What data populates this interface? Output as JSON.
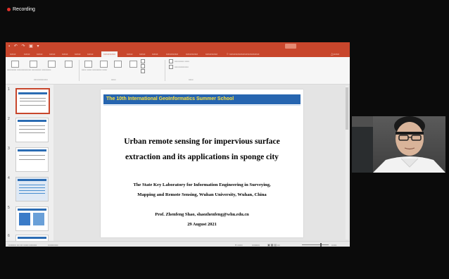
{
  "recording": {
    "label": "Recording"
  },
  "colors": {
    "accent": "#c8462c",
    "slide_banner": "#2665b0",
    "banner_text": "#ffe13a"
  },
  "slide": {
    "banner": "The 10th International GeoInformatics Summer School",
    "title_line1": "Urban remote sensing for impervious surface",
    "title_line2": "extraction and its applications in sponge city",
    "inst_line1": "The State Key Laboratory for Information Engineering in Surveying,",
    "inst_line2": "Mapping and Remote Sensing, Wuhan University, Wuhan, China",
    "author": "Prof. Zhenfeng Shao,  shaozhenfeng@whu.edu.cn",
    "date": "29 August 2021"
  },
  "thumbnails": [
    {
      "num": "1"
    },
    {
      "num": "2"
    },
    {
      "num": "3"
    },
    {
      "num": "4"
    },
    {
      "num": "5"
    },
    {
      "num": "6"
    }
  ],
  "icons": [
    "save-icon",
    "undo-icon",
    "redo-icon",
    "slideshow-icon",
    "search-icon",
    "share-icon",
    "notes-icon",
    "zoom-slider-icon"
  ]
}
